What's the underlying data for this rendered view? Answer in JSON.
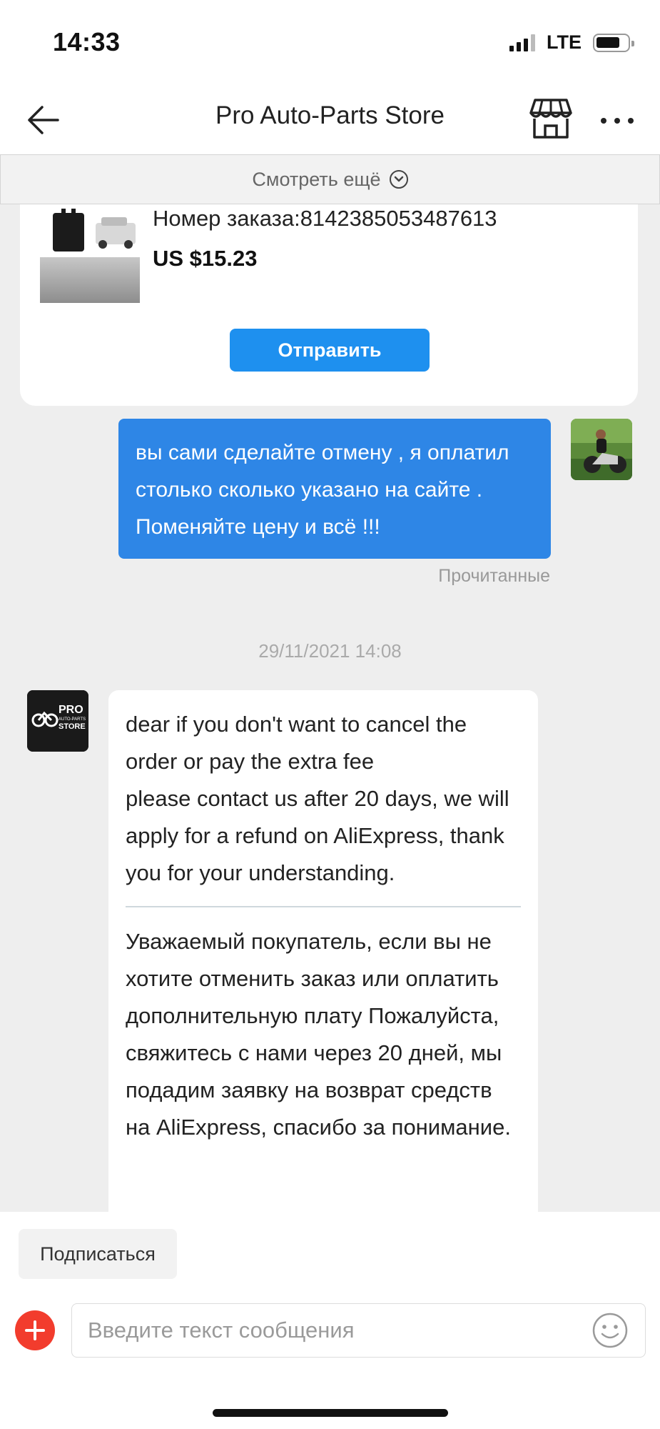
{
  "status_bar": {
    "time": "14:33",
    "network": "LTE"
  },
  "header": {
    "title": "Pro Auto-Parts Store"
  },
  "chat": {
    "see_more_label": "Смотреть ещё",
    "order_card": {
      "order_number": "Номер заказа:8142385053487613",
      "price": "US $15.23",
      "send_label": "Отправить"
    },
    "outgoing_message": {
      "text": "вы сами сделайте отмену , я оплатил столько сколько указано на сайте . Поменяйте цену и всё !!!",
      "status": "Прочитанные"
    },
    "timestamp": "29/11/2021 14:08",
    "incoming_message": {
      "store_logo_text": "PRO AUTO-PARTS STORE",
      "text_en": "dear if you don't want to cancel the order or  pay the extra fee\nplease contact us after 20 days, we will apply for a refund on AliExpress, thank you for your understanding.",
      "text_ru": "Уважаемый покупатель, если вы не хотите отменить заказ или оплатить дополнительную плату Пожалуйста, свяжитесь с нами через 20 дней, мы подадим заявку на возврат средств на AliExpress, спасибо за понимание."
    }
  },
  "footer": {
    "subscribe_label": "Подписаться",
    "input_placeholder": "Введите текст сообщения"
  },
  "colors": {
    "accent_blue": "#2e86e6",
    "button_blue": "#1e90ef",
    "add_red": "#f23c2d",
    "chat_background": "#eeeeee"
  }
}
